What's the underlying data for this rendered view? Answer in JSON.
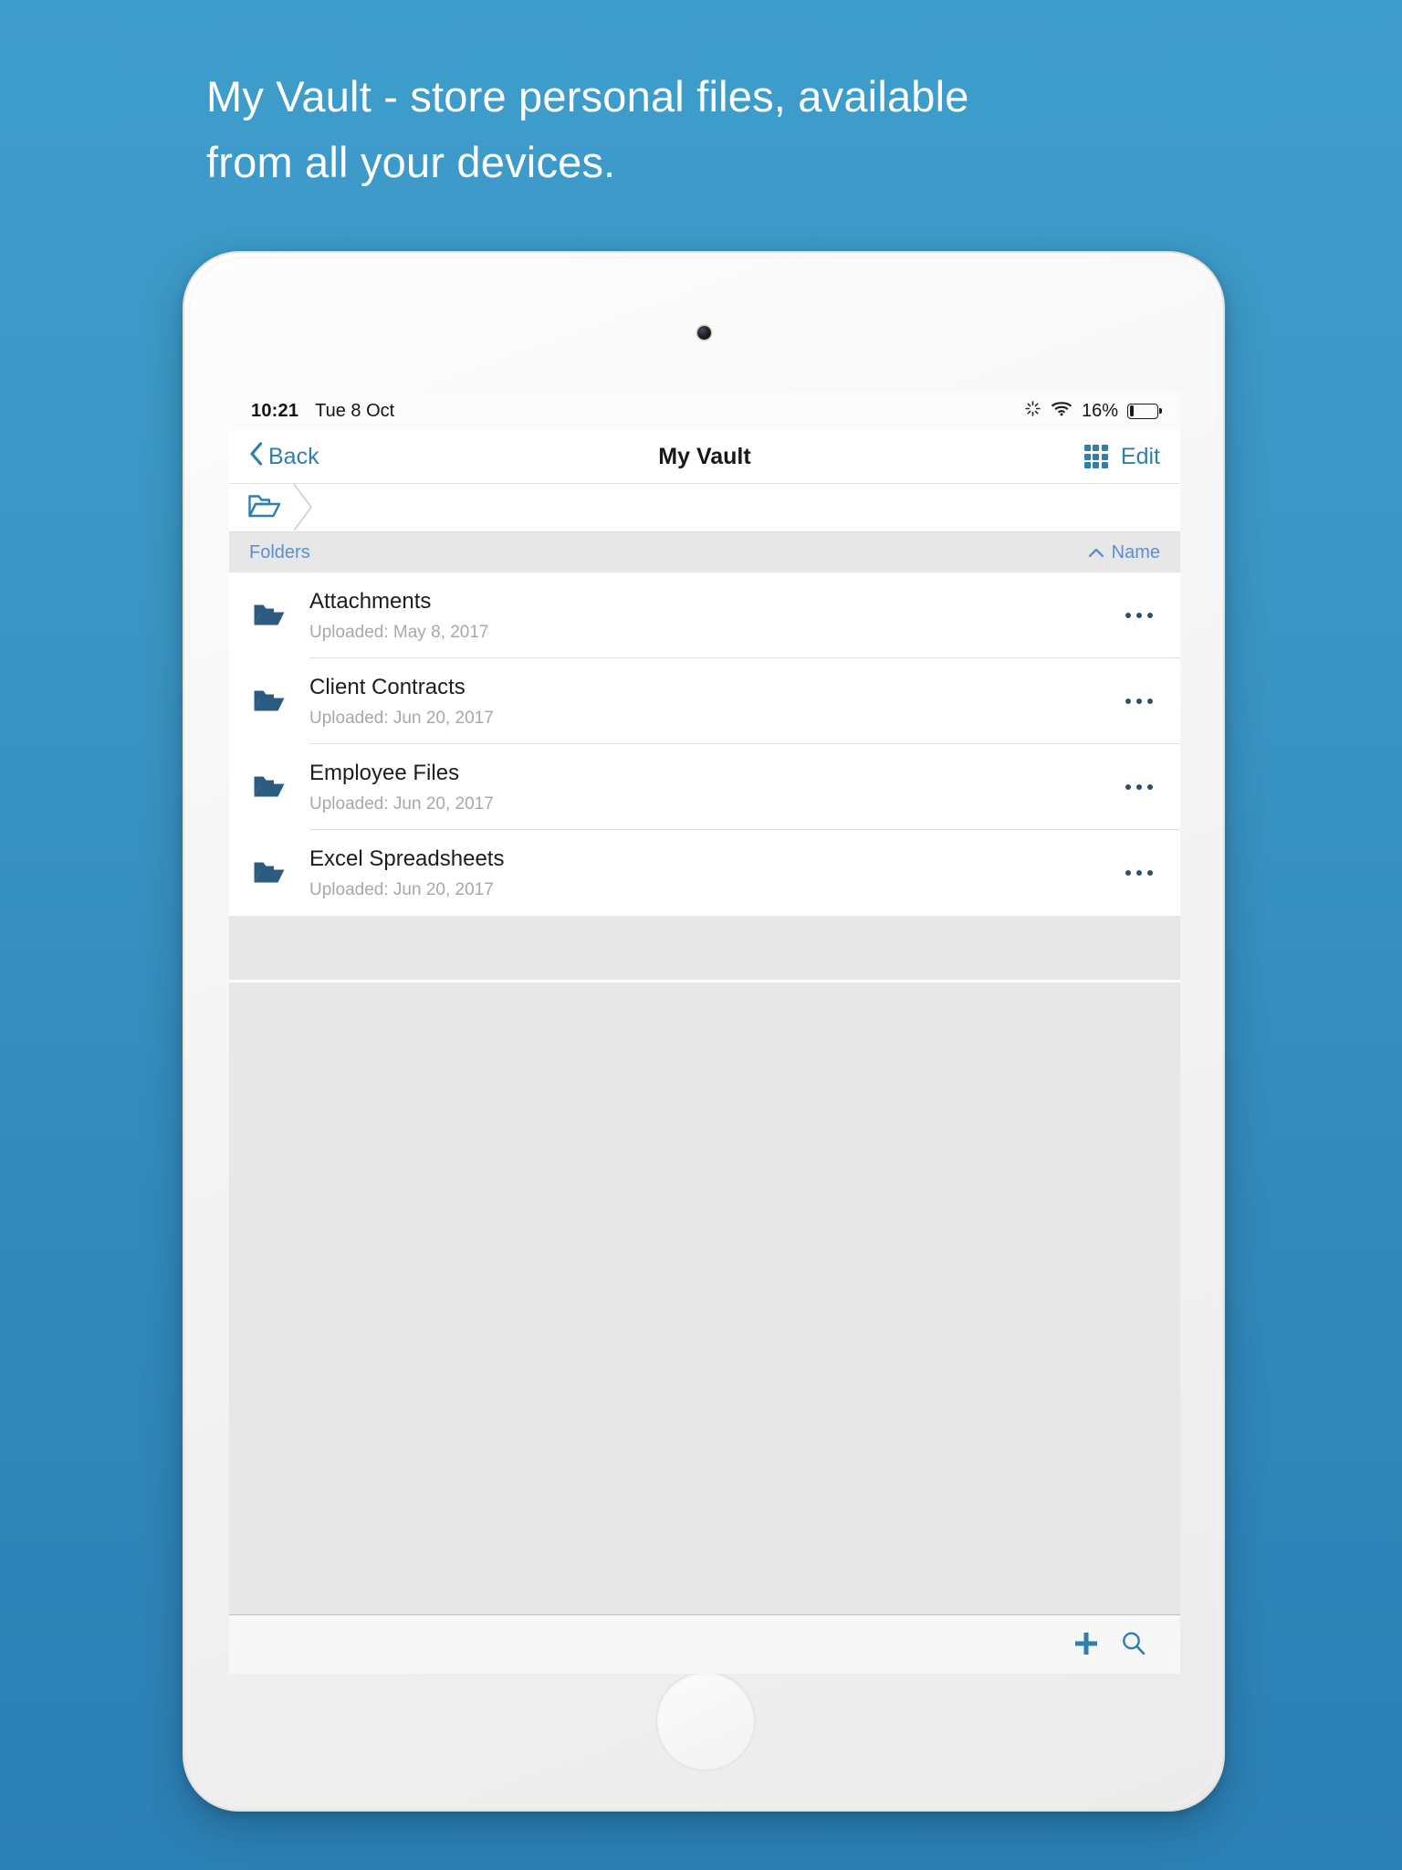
{
  "marketing": {
    "headline_line1": "My Vault - store personal files, available",
    "headline_line2": "from all your devices."
  },
  "theme": {
    "background_top": "#3f9dcb",
    "background_bottom": "#2b80b5",
    "accent_blue": "#2e7fae",
    "folder_icon_blue": "#2c5b80",
    "header_link_blue": "#5b8fd0"
  },
  "status_bar": {
    "time": "10:21",
    "date": "Tue 8 Oct",
    "sync_icon": "sync-spinner-icon",
    "wifi_icon": "wifi-icon",
    "battery_percent": "16%",
    "battery_level": 16
  },
  "nav_bar": {
    "back_label": "Back",
    "back_icon": "chevron-left-icon",
    "title": "My Vault",
    "grid_icon": "grid-view-icon",
    "edit_label": "Edit"
  },
  "breadcrumb": {
    "root_icon": "open-folder-icon",
    "items": [
      {
        "label": "",
        "icon": "open-folder-icon"
      }
    ]
  },
  "list_header": {
    "section_label": "Folders",
    "sort_label": "Name",
    "sort_direction_icon": "chevron-up-icon"
  },
  "folders": [
    {
      "name": "Attachments",
      "meta": "Uploaded: May 8, 2017",
      "icon": "folder-icon",
      "more_icon": "ellipsis-icon"
    },
    {
      "name": "Client Contracts",
      "meta": "Uploaded: Jun 20, 2017",
      "icon": "folder-icon",
      "more_icon": "ellipsis-icon"
    },
    {
      "name": "Employee Files",
      "meta": "Uploaded: Jun 20, 2017",
      "icon": "folder-icon",
      "more_icon": "ellipsis-icon"
    },
    {
      "name": "Excel Spreadsheets",
      "meta": "Uploaded: Jun 20, 2017",
      "icon": "folder-icon",
      "more_icon": "ellipsis-icon"
    }
  ],
  "toolbar": {
    "add_icon": "plus-icon",
    "search_icon": "search-icon"
  }
}
